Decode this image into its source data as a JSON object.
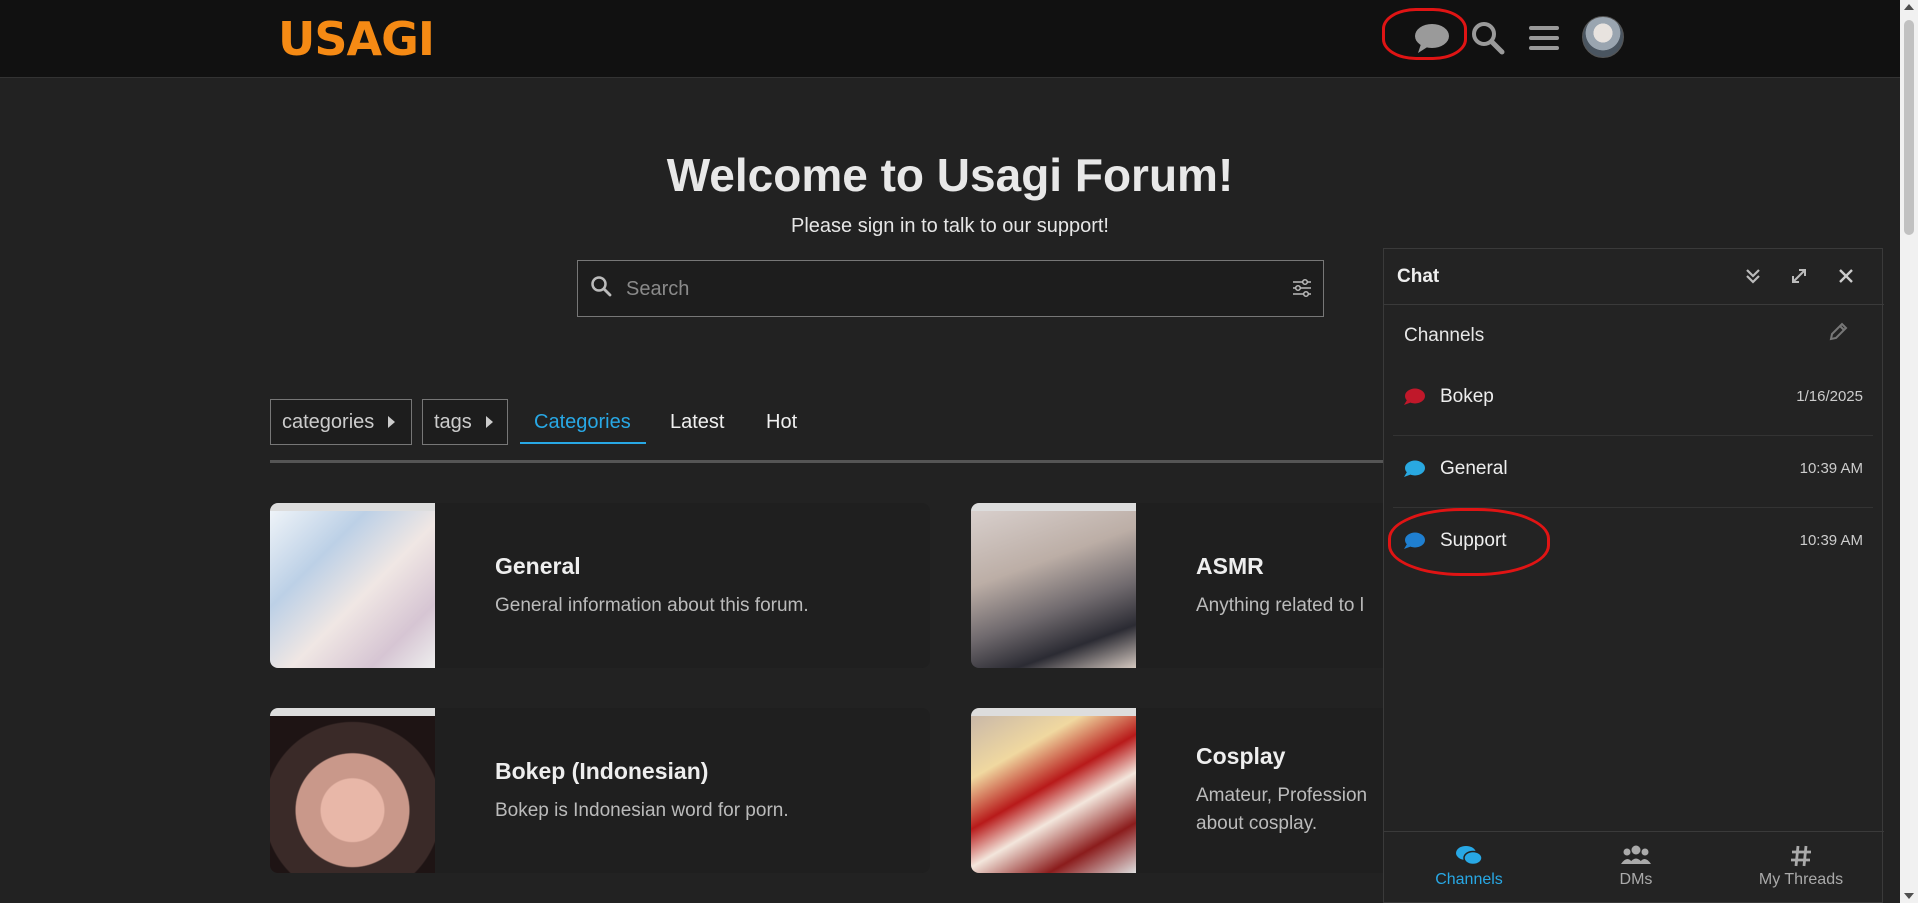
{
  "header": {
    "logo": "USAGI",
    "icons": [
      "chat-icon",
      "search-icon",
      "menu-icon",
      "avatar"
    ]
  },
  "hero": {
    "title": "Welcome to Usagi Forum!",
    "subtitle": "Please sign in to talk to our support!",
    "search_placeholder": "Search"
  },
  "nav": {
    "categories_dropdown": "categories",
    "tags_dropdown": "tags",
    "tabs": [
      {
        "label": "Categories",
        "active": true
      },
      {
        "label": "Latest",
        "active": false
      },
      {
        "label": "Hot",
        "active": false
      }
    ]
  },
  "categories": [
    {
      "title": "General",
      "description": "General information about this forum.",
      "color": "#29a8e0"
    },
    {
      "title": "ASMR",
      "description": "Anything related to l",
      "color": "#8c1f8c"
    },
    {
      "title": "Bokep (Indonesian)",
      "description": "Bokep is Indonesian word for porn.",
      "color": "#c0182a"
    },
    {
      "title": "Cosplay",
      "description": "Amateur, Profession about cosplay.",
      "color": "#e2522a"
    }
  ],
  "chat": {
    "title": "Chat",
    "channels_label": "Channels",
    "channels": [
      {
        "name": "Bokep",
        "time": "1/16/2025",
        "color": "#c0182a"
      },
      {
        "name": "General",
        "time": "10:39 AM",
        "color": "#29a8e0"
      },
      {
        "name": "Support",
        "time": "10:39 AM",
        "color": "#1f7fd0"
      }
    ],
    "footer": [
      {
        "label": "Channels",
        "active": true
      },
      {
        "label": "DMs",
        "active": false
      },
      {
        "label": "My Threads",
        "active": false
      }
    ]
  },
  "colors": {
    "accent": "#28a8e5",
    "logo": "#f58a14",
    "annotation": "#e01414"
  }
}
